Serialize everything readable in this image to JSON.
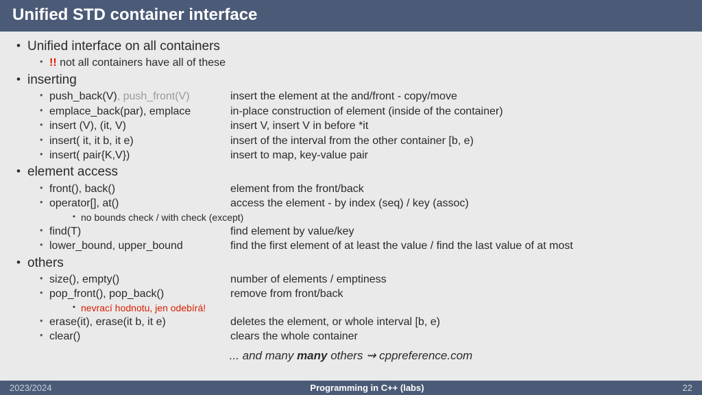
{
  "title": "Unified STD container interface",
  "sections": [
    {
      "label": "Unified interface on all containers",
      "items": [
        {
          "method_pre": "!!",
          "method": " not all containers have all of these",
          "desc": "",
          "note": ""
        }
      ]
    },
    {
      "label": "inserting",
      "items": [
        {
          "method": "push_back(V)",
          "method_gray": ", push_front(V)",
          "desc": "insert the element at the and/front - copy/move"
        },
        {
          "method": "emplace_back(par), emplace",
          "desc": "in-place construction of element (inside of the container)"
        },
        {
          "method": "insert (V), (it, V)",
          "desc": "insert V, insert V in before *it"
        },
        {
          "method": "insert( it, it b, it e)",
          "desc": "insert of the interval from the other container [b, e)"
        },
        {
          "method": "insert( pair{K,V})",
          "desc": "insert to map, key-value pair"
        }
      ]
    },
    {
      "label": "element access",
      "items": [
        {
          "method": "front(), back()",
          "desc": "element from the front/back"
        },
        {
          "method": "operator[], at()",
          "desc": "access the element - by index (seq) / key (assoc)",
          "note": "no bounds check / with check (except)"
        },
        {
          "method": "find(T)",
          "desc": "find element by value/key"
        },
        {
          "method": "lower_bound, upper_bound",
          "desc": "find the first element of at least the value / find the last value of at most"
        }
      ]
    },
    {
      "label": "others",
      "items": [
        {
          "method": "size(), empty()",
          "desc": "number of elements / emptiness"
        },
        {
          "method": "pop_front(), pop_back()",
          "desc": "remove from front/back",
          "note": "nevrací hodnotu, jen odebírá!",
          "note_warn": true
        },
        {
          "method": "erase(it), erase(it b, it e)",
          "desc": "deletes the element, or whole interval [b, e)"
        },
        {
          "method": "clear()",
          "desc": "clears the whole container"
        }
      ]
    }
  ],
  "closing": {
    "pre": "... and many ",
    "many": "many",
    "post": " others ⇝ cppreference.com"
  },
  "footer": {
    "year": "2023/2024",
    "course": "Programming in C++ (labs)",
    "page": "22"
  }
}
